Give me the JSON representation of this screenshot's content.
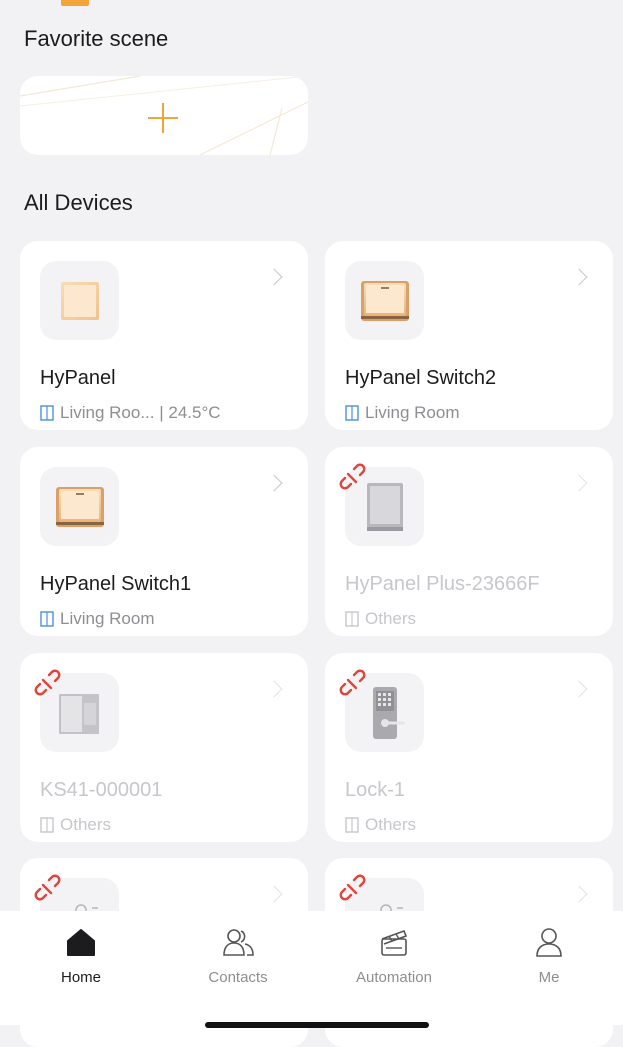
{
  "favorite": {
    "title": "Favorite scene",
    "add_icon": "plus-icon"
  },
  "devices_section": {
    "title": "All Devices"
  },
  "devices": [
    {
      "name": "HyPanel",
      "room": "Living Roo... | 24.5°C",
      "status": "online",
      "icon": "panel-icon"
    },
    {
      "name": "HyPanel Switch2",
      "room": "Living Room",
      "status": "online",
      "icon": "switch-icon"
    },
    {
      "name": "HyPanel Switch1",
      "room": "Living Room",
      "status": "online",
      "icon": "switch-icon"
    },
    {
      "name": "HyPanel Plus-23666F",
      "room": "Others",
      "status": "offline",
      "icon": "panel-plus-icon"
    },
    {
      "name": "KS41-000001",
      "room": "Others",
      "status": "offline",
      "icon": "door-sensor-icon"
    },
    {
      "name": "Lock-1",
      "room": "Others",
      "status": "offline",
      "icon": "smart-lock-icon"
    },
    {
      "name": "",
      "room": "",
      "status": "offline",
      "icon": "sensor-icon"
    },
    {
      "name": "",
      "room": "",
      "status": "offline",
      "icon": "sensor-icon"
    }
  ],
  "nav": {
    "items": [
      {
        "label": "Home",
        "icon": "home-icon",
        "active": true
      },
      {
        "label": "Contacts",
        "icon": "contacts-icon",
        "active": false
      },
      {
        "label": "Automation",
        "icon": "clapperboard-icon",
        "active": false
      },
      {
        "label": "Me",
        "icon": "person-icon",
        "active": false
      }
    ]
  },
  "colors": {
    "accent": "#f2a33a",
    "offline_badge": "#e0443a",
    "room_icon": "#4a90e2",
    "background": "#f2f2f4"
  }
}
